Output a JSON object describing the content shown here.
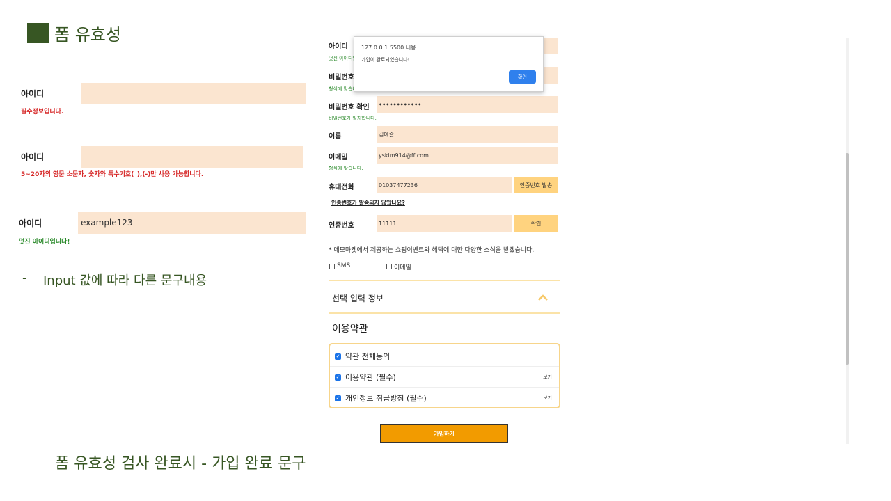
{
  "slide": {
    "title": "폼 유효성",
    "bullet_dash": "-",
    "bullet": "Input 값에 따라 다른 문구내용",
    "caption": "폼 유효성 검사 완료시 - 가입 완료 문구"
  },
  "examples": [
    {
      "label": "아이디",
      "value": "",
      "message": "필수정보입니다.",
      "message_type": "error"
    },
    {
      "label": "아이디",
      "value": "",
      "message": "5~20자의 영문 소문자, 숫자와 특수기호(_),(-)만 사용 가능합니다.",
      "message_type": "error"
    },
    {
      "label": "아이디",
      "value": "example123",
      "message": "멋진 아이디입니다!",
      "message_type": "success"
    }
  ],
  "form": {
    "id": {
      "label": "아이디",
      "message": "멋진 아이디입니다!"
    },
    "password": {
      "label": "비밀번호",
      "message": "형식에 맞습니다."
    },
    "password_confirm": {
      "label": "비밀번호 확인",
      "value": "••••••••••••",
      "message": "비밀번호가 일치합니다."
    },
    "name": {
      "label": "이름",
      "value": "김예슬"
    },
    "email": {
      "label": "이메일",
      "value": "yskim914@ff.com",
      "message": "형식에 맞습니다."
    },
    "phone": {
      "label": "휴대전화",
      "value": "01037477236",
      "button": "인증번호 발송"
    },
    "resend_link": "인증번호가 발송되지 않았나요?",
    "auth": {
      "label": "인증번호",
      "value": "11111",
      "button": "확인"
    },
    "marketing_notice": "* 데모마켓에서 제공하는 쇼핑이벤트와 혜택에 대한 다양한 소식을 받겠습니다.",
    "marketing_sms": "SMS",
    "marketing_email": "이메일",
    "optional_section": "선택 입력 정보",
    "terms_title": "이용약관",
    "terms": [
      {
        "label": "약관 전체동의",
        "view": ""
      },
      {
        "label": "이용약관 (필수)",
        "view": "보기"
      },
      {
        "label": "개인정보 취급방침 (필수)",
        "view": "보기"
      }
    ],
    "submit": "가입하기"
  },
  "alert": {
    "title": "127.0.0.1:5500 내용:",
    "message": "가입이 완료되었습니다!",
    "ok": "확인"
  },
  "colors": {
    "accent_green": "#375623",
    "input_bg": "#fbe5d0",
    "button_gold": "#ffd37f",
    "submit_orange": "#f29b00",
    "error_red": "#d62727",
    "success_green": "#2b8a2b",
    "checkbox_blue": "#1a73e8"
  },
  "icons": {
    "chevron": "chevron-up-icon",
    "check": "checkbox-checked-icon"
  }
}
